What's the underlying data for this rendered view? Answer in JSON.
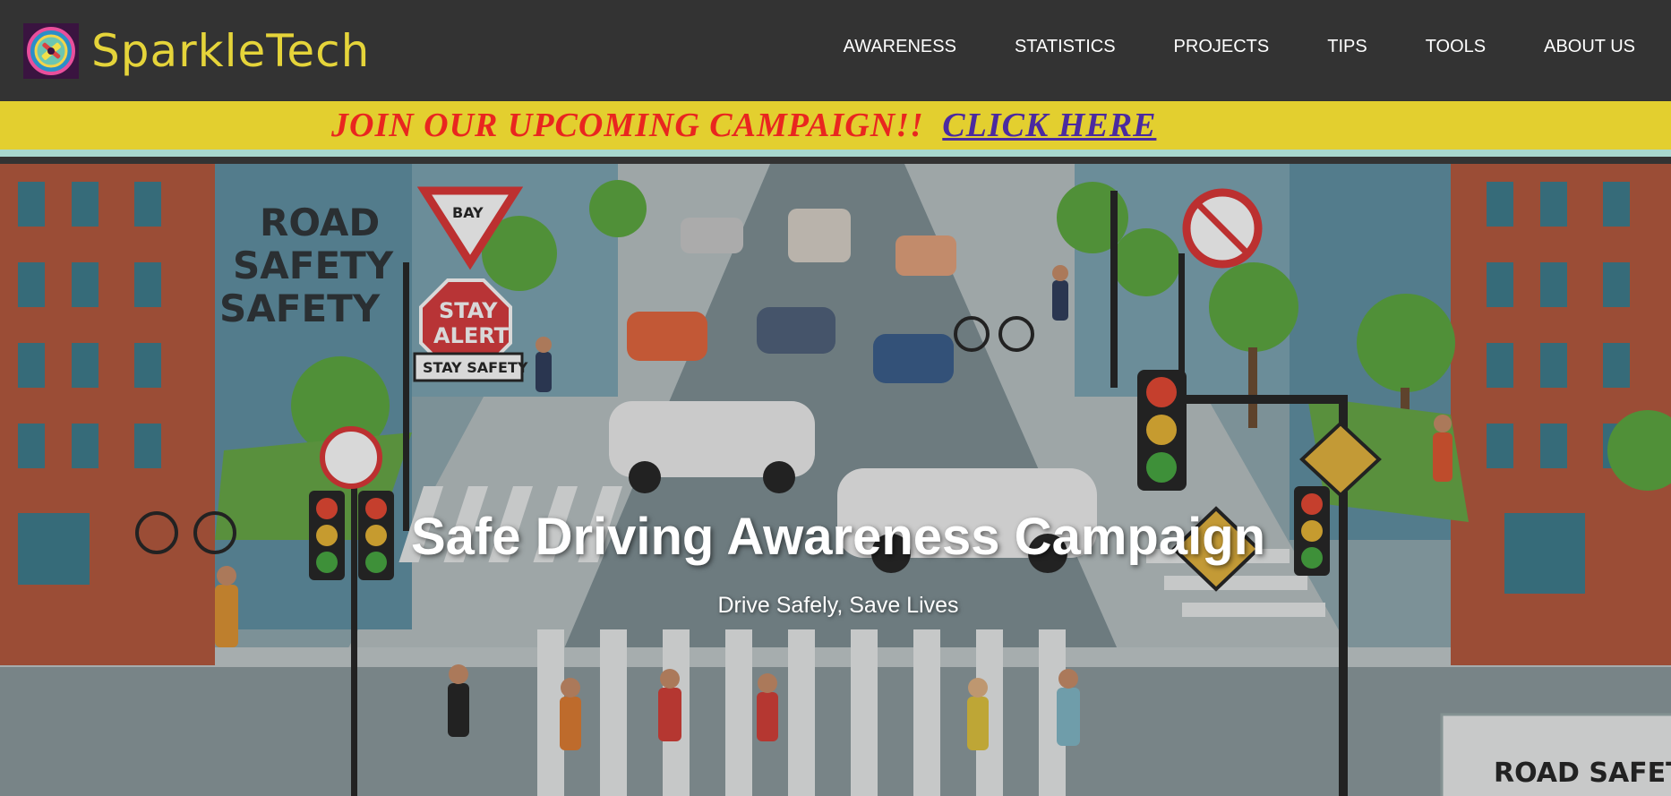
{
  "brand": {
    "name": "SparkleTech"
  },
  "nav": {
    "items": [
      {
        "label": "AWARENESS"
      },
      {
        "label": "STATISTICS"
      },
      {
        "label": "PROJECTS"
      },
      {
        "label": "TIPS"
      },
      {
        "label": "TOOLS"
      },
      {
        "label": "ABOUT US"
      }
    ]
  },
  "banner": {
    "text": "JOIN OUR UPCOMING CAMPAIGN!!",
    "link_label": "CLICK HERE"
  },
  "hero": {
    "title": "Safe Driving Awareness Campaign",
    "subtitle": "Drive Safely, Save Lives",
    "illustration": {
      "wall_text_lines": [
        "ROAD",
        "SAFETY",
        "SAFETY"
      ],
      "yield_sign_text": "BAY",
      "stop_sign_lines": [
        "STAY",
        "ALERT"
      ],
      "plate_sign_text": "STAY SAFETY",
      "corner_sign_text": "ROAD SAFET"
    }
  },
  "colors": {
    "navbar_bg": "#333333",
    "brand_text": "#e5d43a",
    "banner_bg": "#e3cf2f",
    "banner_text": "#e9261f",
    "banner_link": "#4b2aa0"
  },
  "icons": [
    "sparkletech-logo-icon"
  ]
}
